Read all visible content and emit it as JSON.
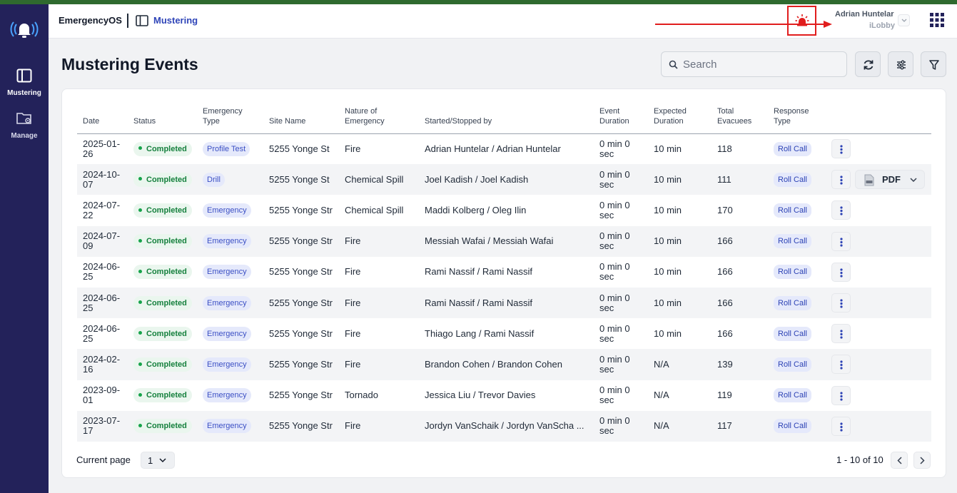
{
  "app": {
    "name": "EmergencyOS",
    "breadcrumb": "Mustering",
    "accent_color": "#23225a",
    "alarm_icon": "emergency-siren-icon"
  },
  "sidebar": {
    "items": [
      {
        "label": "Mustering",
        "icon": "mustering-icon",
        "active": true
      },
      {
        "label": "Manage",
        "icon": "manage-folder-icon",
        "active": false
      }
    ]
  },
  "user": {
    "name": "Adrian Huntelar",
    "org": "iLobby"
  },
  "page": {
    "title": "Mustering Events",
    "search_placeholder": "Search"
  },
  "table": {
    "headers": {
      "date": "Date",
      "status": "Status",
      "emergency_type": "Emergency Type",
      "site_name": "Site Name",
      "nature": "Nature of Emergency",
      "started_stopped": "Started/Stopped by",
      "event_duration": "Event Duration",
      "expected_duration": "Expected Duration",
      "total_evacuees": "Total Evacuees",
      "response_type": "Response Type"
    },
    "rows": [
      {
        "date": "2025-01-26",
        "status": "Completed",
        "type": "Profile Test",
        "site": "5255 Yonge St",
        "nature": "Fire",
        "by": "Adrian Huntelar / Adrian Huntelar",
        "duration": "0 min 0 sec",
        "expected": "10 min",
        "evacuees": "118",
        "response": "Roll Call"
      },
      {
        "date": "2024-10-07",
        "status": "Completed",
        "type": "Drill",
        "site": "5255 Yonge St",
        "nature": "Chemical Spill",
        "by": "Joel Kadish / Joel Kadish",
        "duration": "0 min 0 sec",
        "expected": "10 min",
        "evacuees": "111",
        "response": "Roll Call"
      },
      {
        "date": "2024-07-22",
        "status": "Completed",
        "type": "Emergency",
        "site": "5255 Yonge Str",
        "nature": "Chemical Spill",
        "by": "Maddi Kolberg / Oleg Ilin",
        "duration": "0 min 0 sec",
        "expected": "10 min",
        "evacuees": "170",
        "response": "Roll Call"
      },
      {
        "date": "2024-07-09",
        "status": "Completed",
        "type": "Emergency",
        "site": "5255 Yonge Str",
        "nature": "Fire",
        "by": "Messiah Wafai / Messiah Wafai",
        "duration": "0 min 0 sec",
        "expected": "10 min",
        "evacuees": "166",
        "response": "Roll Call"
      },
      {
        "date": "2024-06-25",
        "status": "Completed",
        "type": "Emergency",
        "site": "5255 Yonge Str",
        "nature": "Fire",
        "by": "Rami Nassif / Rami Nassif",
        "duration": "0 min 0 sec",
        "expected": "10 min",
        "evacuees": "166",
        "response": "Roll Call"
      },
      {
        "date": "2024-06-25",
        "status": "Completed",
        "type": "Emergency",
        "site": "5255 Yonge Str",
        "nature": "Fire",
        "by": "Rami Nassif / Rami Nassif",
        "duration": "0 min 0 sec",
        "expected": "10 min",
        "evacuees": "166",
        "response": "Roll Call"
      },
      {
        "date": "2024-06-25",
        "status": "Completed",
        "type": "Emergency",
        "site": "5255 Yonge Str",
        "nature": "Fire",
        "by": "Thiago Lang / Rami Nassif",
        "duration": "0 min 0 sec",
        "expected": "10 min",
        "evacuees": "166",
        "response": "Roll Call"
      },
      {
        "date": "2024-02-16",
        "status": "Completed",
        "type": "Emergency",
        "site": "5255 Yonge Str",
        "nature": "Fire",
        "by": "Brandon Cohen / Brandon Cohen",
        "duration": "0 min 0 sec",
        "expected": "N/A",
        "evacuees": "139",
        "response": "Roll Call"
      },
      {
        "date": "2023-09-01",
        "status": "Completed",
        "type": "Emergency",
        "site": "5255 Yonge Str",
        "nature": "Tornado",
        "by": "Jessica Liu / Trevor Davies",
        "duration": "0 min 0 sec",
        "expected": "N/A",
        "evacuees": "119",
        "response": "Roll Call"
      },
      {
        "date": "2023-07-17",
        "status": "Completed",
        "type": "Emergency",
        "site": "5255 Yonge Str",
        "nature": "Fire",
        "by": "Jordyn VanSchaik / Jordyn VanScha ...",
        "duration": "0 min 0 sec",
        "expected": "N/A",
        "evacuees": "117",
        "response": "Roll Call"
      }
    ],
    "export": {
      "label": "PDF",
      "icon": "pdf-file-icon"
    }
  },
  "pagination": {
    "current_page_label": "Current page",
    "current_page": "1",
    "range": "1 - 10 of 10"
  }
}
